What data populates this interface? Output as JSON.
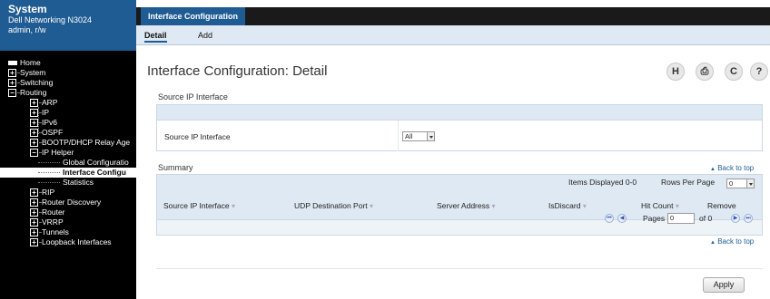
{
  "sidebar": {
    "title": "System",
    "device": "Dell Networking N3024",
    "user": "admin, r/w",
    "items": [
      {
        "label": "Home",
        "icon": "home-icon"
      },
      {
        "label": "System",
        "icon": "expand-icon"
      },
      {
        "label": "Switching",
        "icon": "expand-icon"
      },
      {
        "label": "Routing",
        "icon": "collapse-icon"
      },
      {
        "label": "ARP",
        "icon": "expand-icon"
      },
      {
        "label": "IP",
        "icon": "expand-icon"
      },
      {
        "label": "IPv6",
        "icon": "expand-icon"
      },
      {
        "label": "OSPF",
        "icon": "expand-icon"
      },
      {
        "label": "BOOTP/DHCP Relay Age",
        "icon": "expand-icon"
      },
      {
        "label": "IP Helper",
        "icon": "collapse-icon"
      },
      {
        "label": "Global Configuratio",
        "icon": ""
      },
      {
        "label": "Interface Configu",
        "icon": ""
      },
      {
        "label": "Statistics",
        "icon": ""
      },
      {
        "label": "RIP",
        "icon": "expand-icon"
      },
      {
        "label": "Router Discovery",
        "icon": "expand-icon"
      },
      {
        "label": "Router",
        "icon": "expand-icon"
      },
      {
        "label": "VRRP",
        "icon": "expand-icon"
      },
      {
        "label": "Tunnels",
        "icon": "expand-icon"
      },
      {
        "label": "Loopback Interfaces",
        "icon": "expand-icon"
      }
    ]
  },
  "tabs": {
    "main": "Interface Configuration",
    "sub": [
      "Detail",
      "Add"
    ]
  },
  "page": {
    "title": "Interface Configuration: Detail",
    "icons": [
      {
        "name": "help-h-icon",
        "glyph": "H"
      },
      {
        "name": "print-icon",
        "glyph": "⎙"
      },
      {
        "name": "refresh-icon",
        "glyph": "C"
      },
      {
        "name": "question-icon",
        "glyph": "?"
      }
    ]
  },
  "source_section": {
    "label": "Source IP Interface",
    "field_label": "Source IP Interface",
    "select_value": "All"
  },
  "summary": {
    "label": "Summary",
    "back_to_top": "Back to top",
    "items_displayed": "Items Displayed 0-0",
    "rows_per_page_label": "Rows Per Page",
    "rows_per_page_value": "0",
    "columns": [
      "Source IP Interface",
      "UDP Destination Port",
      "Server Address",
      "IsDiscard",
      "Hit Count",
      "Remove"
    ],
    "pages_label": "Pages",
    "page_value": "0",
    "of_label": "of 0"
  },
  "footer": {
    "back_to_top": "Back to top",
    "apply_label": "Apply"
  },
  "colors": {
    "brand_blue": "#1f5c93",
    "panel_blue": "#dfe9f3",
    "sidebar_bg": "#000000"
  }
}
